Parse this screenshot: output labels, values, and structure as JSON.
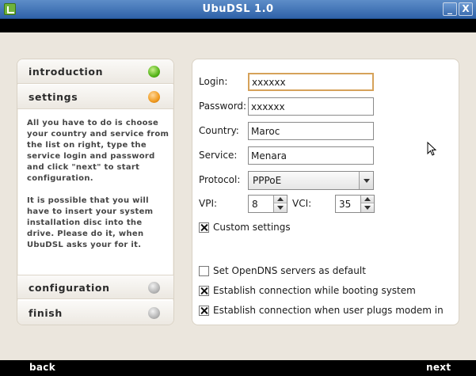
{
  "window": {
    "title": "UbuDSL 1.0",
    "minimize_label": "_",
    "close_label": "X"
  },
  "steps": [
    {
      "label": "introduction",
      "status": "green"
    },
    {
      "label": "settings",
      "status": "orange"
    },
    {
      "label": "configuration",
      "status": "gray"
    },
    {
      "label": "finish",
      "status": "gray"
    }
  ],
  "description": {
    "paragraph1": "All you have to do is choose your country and service from the list on right, type the service login and password and click \"next\" to start configuration.",
    "paragraph2": "It is possible that you will have to insert your system installation disc into the drive. Please do it, when UbuDSL asks your for it."
  },
  "form": {
    "login_label": "Login:",
    "login_value": "xxxxxx",
    "password_label": "Password:",
    "password_value": "xxxxxx",
    "country_label": "Country:",
    "country_value": "Maroc",
    "service_label": "Service:",
    "service_value": "Menara",
    "protocol_label": "Protocol:",
    "protocol_value": "PPPoE",
    "vpi_label": "VPI:",
    "vpi_value": "8",
    "vci_label": "VCI:",
    "vci_value": "35",
    "custom_settings": {
      "label": "Custom settings",
      "checked": true
    },
    "opendns": {
      "label": "Set OpenDNS servers as default",
      "checked": false
    },
    "connect_boot": {
      "label": "Establish connection while booting system",
      "checked": true
    },
    "connect_plug": {
      "label": "Establish connection when user plugs modem in",
      "checked": true
    }
  },
  "nav": {
    "back_label": "back",
    "next_label": "next"
  },
  "colors": {
    "titlebar": "#3a6db0",
    "background": "#ebe6dd",
    "active_step": "#f09a1e",
    "done_step": "#55b418",
    "pending_step": "#b5b5b5"
  }
}
